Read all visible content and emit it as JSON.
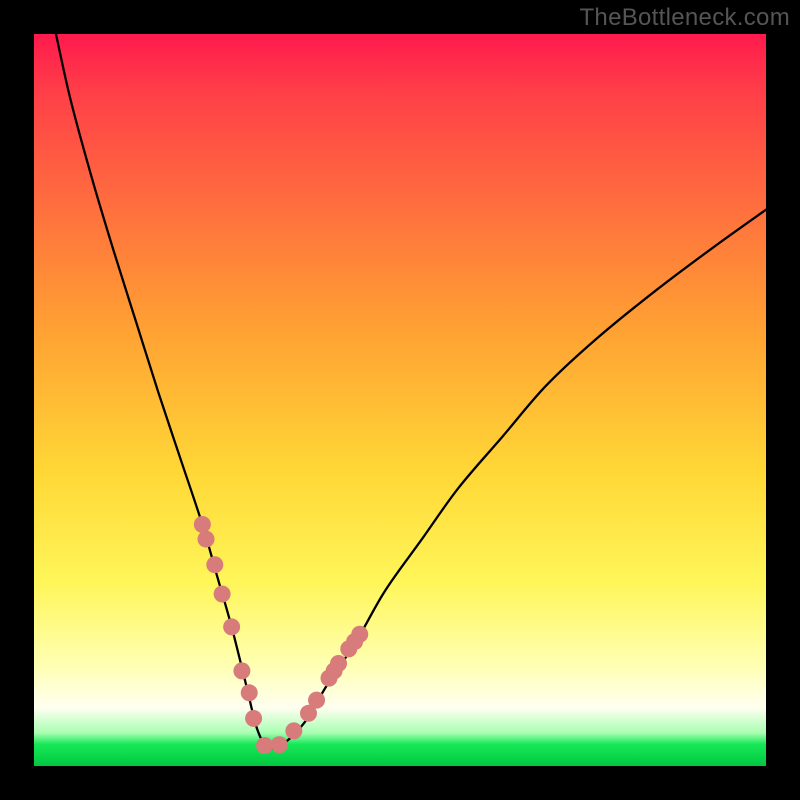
{
  "watermark": "TheBottleneck.com",
  "chart_data": {
    "type": "line",
    "title": "",
    "xlabel": "",
    "ylabel": "",
    "xlim": [
      0,
      100
    ],
    "ylim": [
      0,
      100
    ],
    "series": [
      {
        "name": "bottleneck-curve",
        "x": [
          3,
          5,
          8,
          11,
          14,
          17,
          20,
          23,
          25,
          27,
          29,
          30.5,
          32,
          34,
          37,
          40,
          44,
          48,
          53,
          58,
          64,
          70,
          77,
          85,
          93,
          100
        ],
        "values": [
          100,
          91,
          80,
          70,
          60.5,
          51,
          42,
          33,
          26,
          19,
          11,
          5,
          2.5,
          3,
          6,
          11,
          17,
          24,
          31,
          38,
          45,
          52,
          58.5,
          65,
          71,
          76
        ]
      }
    ],
    "markers": {
      "name": "highlight-points",
      "color": "#d77b7b",
      "x": [
        23.0,
        23.5,
        24.7,
        25.7,
        27.0,
        28.4,
        29.4,
        30.0,
        31.5,
        33.5,
        35.5,
        37.5,
        38.6,
        40.3,
        41.0,
        41.6,
        43.0,
        43.8,
        44.5
      ],
      "values": [
        33.0,
        31.0,
        27.5,
        23.5,
        19.0,
        13.0,
        10.0,
        6.5,
        2.8,
        2.9,
        4.8,
        7.2,
        9.0,
        12.0,
        13.0,
        14.0,
        16.0,
        17.0,
        18.0
      ]
    },
    "gradient_stops": [
      {
        "pos": 0,
        "color": "#ff1a4d"
      },
      {
        "pos": 22,
        "color": "#ff6a3f"
      },
      {
        "pos": 60,
        "color": "#ffd836"
      },
      {
        "pos": 92,
        "color": "#fffff0"
      },
      {
        "pos": 100,
        "color": "#00c840"
      }
    ]
  }
}
